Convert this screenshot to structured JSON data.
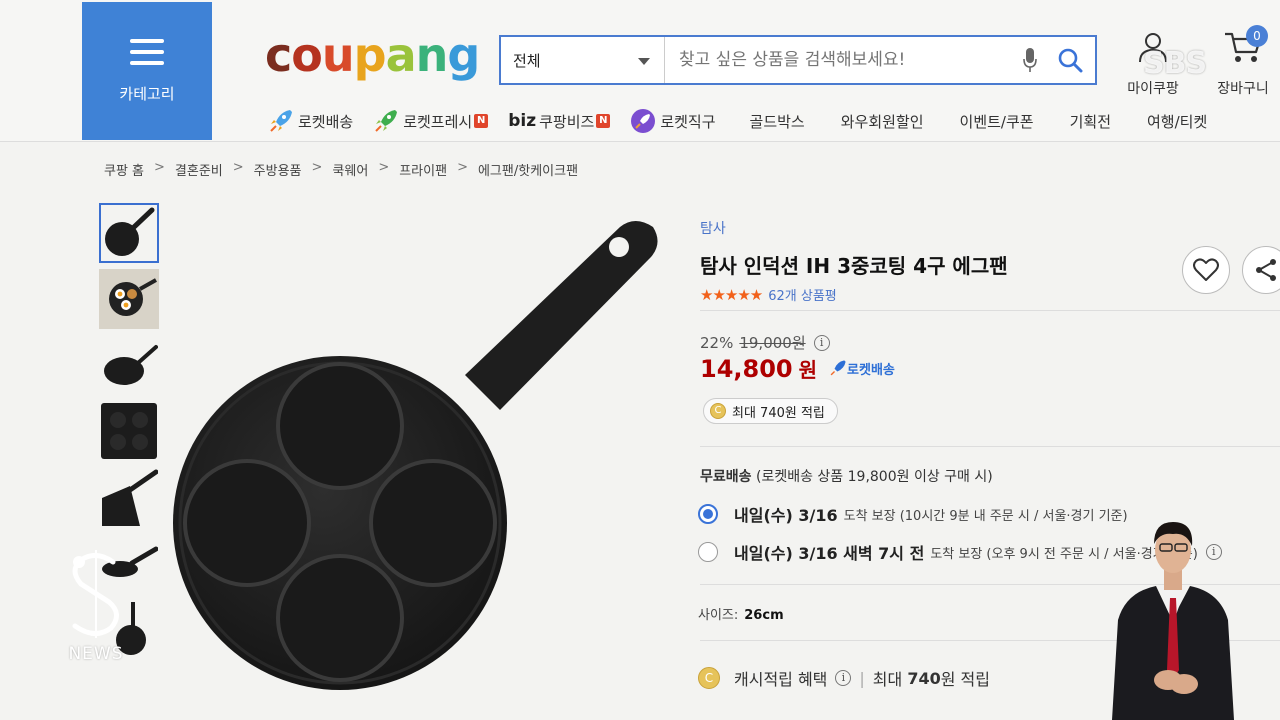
{
  "header": {
    "category_label": "카테고리",
    "logo": [
      "c",
      "o",
      "u",
      "p",
      "a",
      "n",
      "g"
    ],
    "search": {
      "scope": "전체",
      "placeholder": "찾고 싶은 상품을 검색해보세요!"
    },
    "my_label": "마이쿠팡",
    "cart_label": "장바구니",
    "cart_count": "0",
    "broadcaster": "SBS"
  },
  "nav": {
    "rocket_delivery": "로켓배송",
    "rocket_fresh": "로켓프레시",
    "biz_prefix": "biz",
    "biz_label": "쿠팡비즈",
    "rocket_direct": "로켓직구",
    "goldbox": "골드박스",
    "wow_sale": "와우회원할인",
    "events": "이벤트/쿠폰",
    "special": "기획전",
    "travel": "여행/티켓",
    "new_badge": "N"
  },
  "breadcrumb": [
    "쿠팡 홈",
    "결혼준비",
    "주방용품",
    "쿡웨어",
    "프라이팬",
    "에그팬/핫케이크팬"
  ],
  "product": {
    "brand": "탐사",
    "title": "탐사 인덕션 IH 3중코팅 4구 에그팬",
    "stars": "★★★★★",
    "review_count": "62개 상품평",
    "discount_rate": "22%",
    "original_price": "19,000원",
    "price": "14,800",
    "price_unit": "원",
    "rocket_badge": "로켓배송",
    "reward": "최대 740원 적립",
    "coin_symbol": "C"
  },
  "shipping": {
    "free_label": "무료배송",
    "free_condition": "(로켓배송 상품 19,800원 이상 구매 시)",
    "options": [
      {
        "label": "내일(수) 3/16",
        "detail": "도착 보장 (10시간 9분 내 주문 시 / 서울·경기 기준)",
        "selected": true
      },
      {
        "label": "내일(수) 3/16 새벽 7시 전",
        "detail": "도착 보장 (오후 9시 전 주문 시 / 서울·경기 기준)",
        "selected": false
      }
    ]
  },
  "size": {
    "label": "사이즈:",
    "value": "26cm"
  },
  "cash": {
    "label": "캐시적립 혜택",
    "prefix": "최대",
    "amount": "740",
    "suffix": "원 적립"
  },
  "overlay": {
    "s_letter": "S",
    "news": "NEWS"
  },
  "colors": {
    "accent": "#3f82d6",
    "price": "#ae0000",
    "link": "#4a74c9",
    "rating": "#f2611a"
  }
}
